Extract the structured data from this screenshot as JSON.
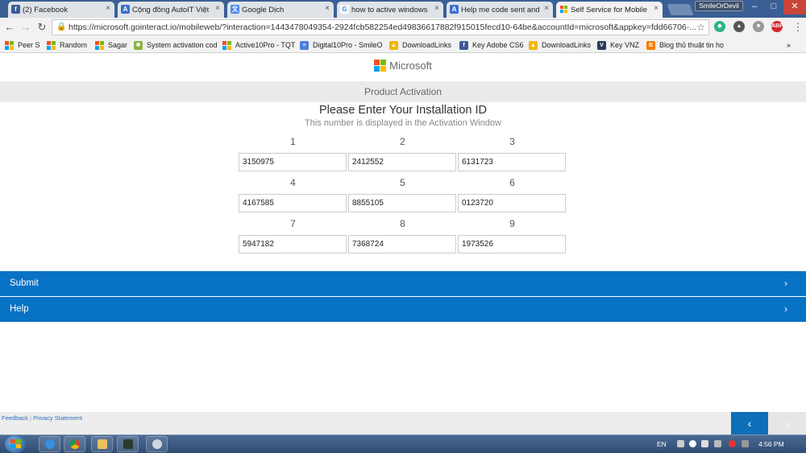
{
  "browser": {
    "tabs": [
      {
        "label": "(2) Facebook",
        "icon": "facebook-icon",
        "color": "#3b5998",
        "glyph": "f"
      },
      {
        "label": "Cộng đồng AutoIT Việt",
        "icon": "autoit-icon",
        "color": "#3a6fd1",
        "glyph": "A"
      },
      {
        "label": "Google Dịch",
        "icon": "google-translate-icon",
        "color": "#4a88e8",
        "glyph": "文"
      },
      {
        "label": "how to active windows",
        "icon": "google-icon",
        "color": "#ffffff",
        "glyph": "G"
      },
      {
        "label": "Help me code sent and",
        "icon": "autoit-icon",
        "color": "#3a6fd1",
        "glyph": "A"
      },
      {
        "label": "Self Service for Mobile",
        "icon": "microsoft-icon",
        "color": "#ffffff",
        "glyph": ""
      }
    ],
    "profile_name": "SmileOrDevil",
    "url": "https://microsoft.gointeract.io/mobileweb/?interaction=1443478049354-2924fcb582254ed49836617882f915015fecd10-64be&accountId=microsoft&appkey=fdd66706-...",
    "extensions": [
      {
        "icon": "shield-extension-icon",
        "color": "#2bb38b",
        "glyph": "◆"
      },
      {
        "icon": "artifact-extension-icon",
        "color": "#555555",
        "glyph": "▲"
      },
      {
        "icon": "puzzle-extension-icon",
        "color": "#999999",
        "glyph": "■"
      },
      {
        "icon": "adblock-plus-icon",
        "color": "#d9232d",
        "glyph": "ABP"
      }
    ],
    "bookmarks": [
      {
        "label": "Peer S",
        "icon": "microsoft-logo-icon",
        "type": "ms"
      },
      {
        "label": "Random",
        "icon": "microsoft-logo-icon",
        "type": "ms"
      },
      {
        "label": "Sagar",
        "icon": "microsoft-logo-icon",
        "type": "ms"
      },
      {
        "label": "System activation cod",
        "icon": "android-icon",
        "type": "color",
        "color": "#8ab43c",
        "glyph": "✱"
      },
      {
        "label": "Active10Pro - TQT",
        "icon": "microsoft-logo-icon",
        "type": "ms"
      },
      {
        "label": "Digital10Pro - SmileO",
        "icon": "google-docs-icon",
        "type": "color",
        "color": "#4a7fe0",
        "glyph": "≡"
      },
      {
        "label": "DownloadLinks",
        "icon": "google-drive-icon",
        "type": "color",
        "color": "#f2b600",
        "glyph": "▲"
      },
      {
        "label": "Key Adobe CS6",
        "icon": "facebook-icon",
        "type": "color",
        "color": "#3b5998",
        "glyph": "f"
      },
      {
        "label": "DownloadLinks",
        "icon": "google-drive-icon",
        "type": "color",
        "color": "#f2b600",
        "glyph": "▲"
      },
      {
        "label": "Key VNZ",
        "icon": "vnz-icon",
        "type": "color",
        "color": "#2a3a5c",
        "glyph": "V"
      },
      {
        "label": "Blog thủ thuật tin họ",
        "icon": "blogger-icon",
        "type": "color",
        "color": "#f57d00",
        "glyph": "B"
      }
    ],
    "more_bookmarks": "»"
  },
  "page": {
    "brand": "Microsoft",
    "section_title": "Product Activation",
    "heading": "Please Enter Your Installation ID",
    "subheading": "This number is displayed in the Activation Window",
    "id_groups": [
      {
        "label": "1",
        "value": "3150975"
      },
      {
        "label": "2",
        "value": "2412552"
      },
      {
        "label": "3",
        "value": "6131723"
      },
      {
        "label": "4",
        "value": "4167585"
      },
      {
        "label": "5",
        "value": "8855105"
      },
      {
        "label": "6",
        "value": "0123720"
      },
      {
        "label": "7",
        "value": "5947182"
      },
      {
        "label": "8",
        "value": "7368724"
      },
      {
        "label": "9",
        "value": "1973526"
      }
    ],
    "submit_label": "Submit",
    "help_label": "Help",
    "feedback_label": "Feedback",
    "privacy_label": "Privacy Statement",
    "separator": "|"
  },
  "taskbar": {
    "language": "EN",
    "time": "4:56 PM"
  },
  "colors": {
    "accent": "#0872c4",
    "ms_red": "#f25022",
    "ms_green": "#7fba00",
    "ms_blue": "#00a4ef",
    "ms_yellow": "#ffb900"
  }
}
